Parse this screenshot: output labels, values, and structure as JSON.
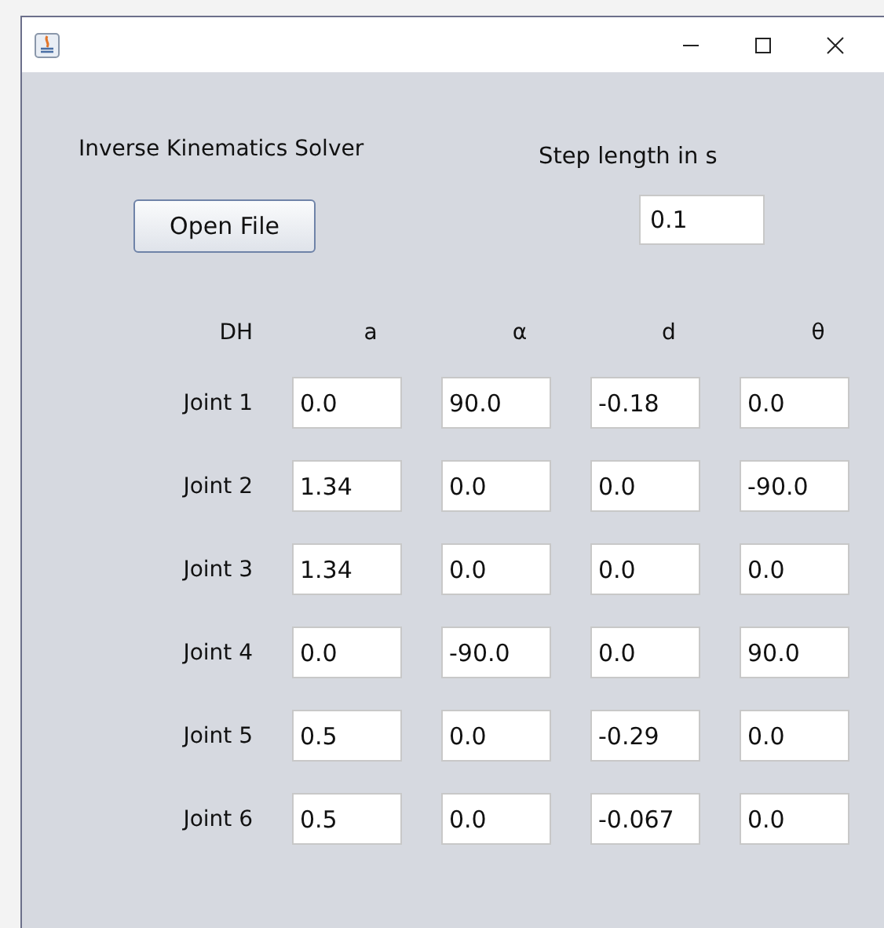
{
  "panel": {
    "title": "Inverse Kinematics Solver",
    "open_button": "Open File",
    "step_label": "Step length in s",
    "step_value": "0.1"
  },
  "table": {
    "columns": [
      "DH",
      "a",
      "α",
      "d",
      "θ"
    ],
    "rows": [
      {
        "label": "Joint 1",
        "values": [
          "0.0",
          "90.0",
          "-0.18",
          "0.0"
        ]
      },
      {
        "label": "Joint 2",
        "values": [
          "1.34",
          "0.0",
          "0.0",
          "-90.0"
        ]
      },
      {
        "label": "Joint 3",
        "values": [
          "1.34",
          "0.0",
          "0.0",
          "0.0"
        ]
      },
      {
        "label": "Joint 4",
        "values": [
          "0.0",
          "-90.0",
          "0.0",
          "90.0"
        ]
      },
      {
        "label": "Joint 5",
        "values": [
          "0.5",
          "0.0",
          "-0.29",
          "0.0"
        ]
      },
      {
        "label": "Joint 6",
        "values": [
          "0.5",
          "0.0",
          "-0.067",
          "0.0"
        ]
      }
    ]
  }
}
